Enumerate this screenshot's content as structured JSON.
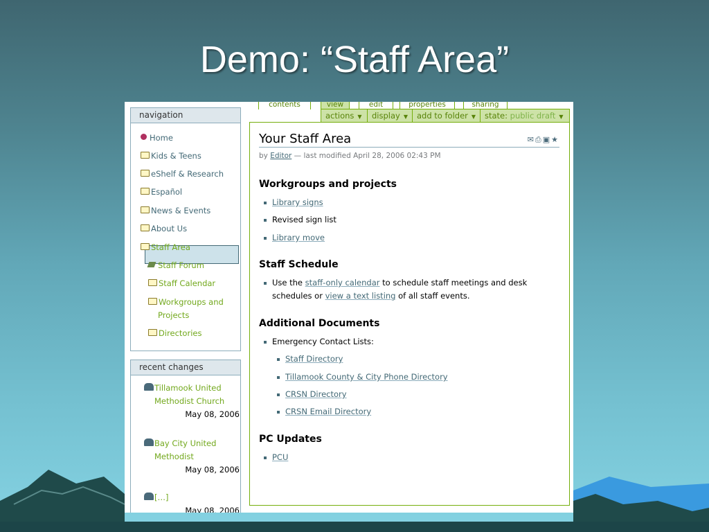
{
  "slide": {
    "title": "Demo: “Staff Area”"
  },
  "navigation": {
    "header": "navigation",
    "items": [
      {
        "label": "Home"
      },
      {
        "label": "Kids & Teens"
      },
      {
        "label": "eShelf & Research"
      },
      {
        "label": "Español"
      },
      {
        "label": "News & Events"
      },
      {
        "label": "About Us"
      },
      {
        "label": "Staff Area"
      },
      {
        "label": "Staff Forum"
      },
      {
        "label": "Staff Calendar"
      },
      {
        "label": "Workgroups and"
      },
      {
        "label": "Projects"
      },
      {
        "label": "Directories"
      }
    ]
  },
  "recent_changes": {
    "header": "recent changes",
    "entries": [
      {
        "line1": "Tillamook United",
        "line2": "Methodist Church",
        "date": "May 08, 2006"
      },
      {
        "line1": "Bay City United",
        "line2": "Methodist",
        "date": "May 08, 2006"
      },
      {
        "line1": "[…]",
        "date": "May 08, 2006"
      }
    ]
  },
  "tabs": [
    "contents",
    "view",
    "edit",
    "properties",
    "sharing"
  ],
  "actions": {
    "actions_label": "actions",
    "display_label": "display",
    "add_label": "add to folder",
    "state_prefix": "state:",
    "state_value": "public draft"
  },
  "document": {
    "title": "Your Staff Area",
    "byline_prefix": "by",
    "author": "Editor",
    "byline_suffix": "— last modified April 28, 2006 02:43 PM",
    "sections": {
      "workgroups": {
        "heading": "Workgroups and projects",
        "items": [
          "Library signs",
          "Revised sign list",
          "Library move"
        ]
      },
      "schedule": {
        "heading": "Staff Schedule",
        "text1": "Use the",
        "link1": "staff-only calendar",
        "text2": "to schedule staff meetings and desk",
        "text3": "schedules or",
        "link2": "view a text listing",
        "text4": "of all staff events."
      },
      "additional": {
        "heading": "Additional Documents",
        "intro": "Emergency Contact Lists:",
        "items": [
          "Staff Directory",
          "Tillamook County & City Phone Directory",
          "CRSN Directory",
          "CRSN Email Directory"
        ]
      },
      "pc": {
        "heading": "PC Updates",
        "items": [
          "PCU"
        ]
      }
    }
  }
}
